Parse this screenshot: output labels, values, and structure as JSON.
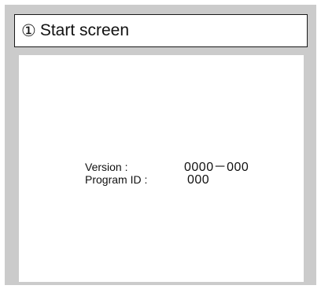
{
  "title": {
    "number": "①",
    "text": "Start screen"
  },
  "screen": {
    "version_label": "Version :",
    "version_value": "0000－000",
    "program_id_label": "Program ID :",
    "program_id_value": "000"
  },
  "colors": {
    "frame_background": "#cbcbcb",
    "screen_background": "#ffffff",
    "text": "#111111"
  }
}
